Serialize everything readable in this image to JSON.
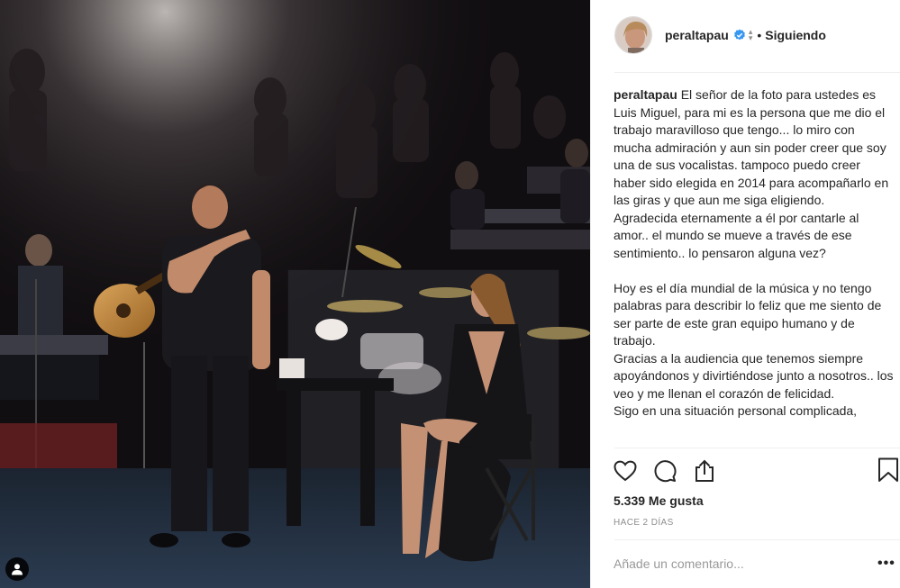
{
  "post": {
    "username": "peraltapau",
    "follow_status": "Siguiendo",
    "separator": "•",
    "caption_paragraphs": [
      "El señor de la foto para ustedes es Luis Miguel, para mi es la persona que me dio el trabajo maravilloso que tengo... lo miro con mucha admiración y aun sin poder creer que soy una de sus vocalistas. tampoco puedo creer haber sido elegida en 2014 para acompañarlo en las giras y que aun me siga eligiendo.",
      "Agradecida eternamente a él por cantarle al amor.. el mundo se mueve a través de ese sentimiento.. lo pensaron alguna vez?",
      "",
      "Hoy es el día mundial de la música y no tengo palabras para describir lo feliz que me siento de ser parte de este gran equipo humano y de trabajo.",
      "Gracias a la audiencia que tenemos siempre apoyándonos y divirtiéndose junto a nosotros.. los veo y me llenan el corazón de felicidad.",
      "Sigo en una situación personal complicada,"
    ],
    "likes": "5.339 Me gusta",
    "time_ago": "HACE 2 DÍAS",
    "comment_placeholder": "Añade un comentario...",
    "options_label": "•••"
  },
  "icons": {
    "verified": "verified-badge-icon",
    "like": "heart-icon",
    "comment": "comment-bubble-icon",
    "share": "share-icon",
    "save": "bookmark-icon",
    "tag": "user-tag-icon"
  },
  "colors": {
    "verified": "#3897f0",
    "text": "#262626",
    "muted": "#8e8e8e",
    "divider": "#efefef"
  }
}
